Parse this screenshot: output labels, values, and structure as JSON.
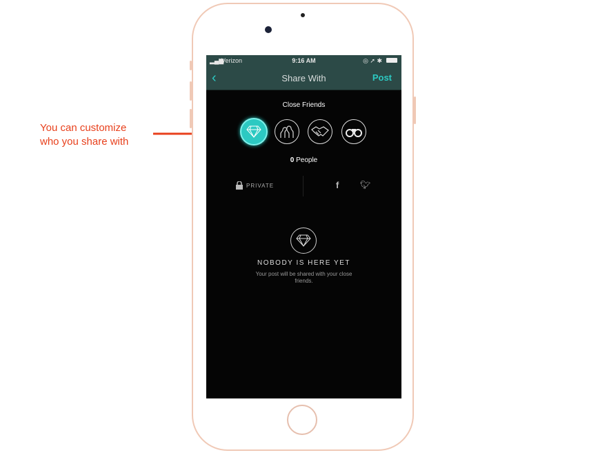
{
  "annotation": {
    "text_line1": "You can customize",
    "text_line2": "who you share with",
    "color": "#e8401c"
  },
  "status_bar": {
    "carrier": "Verizon",
    "time": "9:16 AM"
  },
  "nav": {
    "title": "Share With",
    "post_label": "Post",
    "accent": "#2cc9c2"
  },
  "audience": {
    "selected_label": "Close Friends",
    "options": [
      "diamond-icon",
      "group-icon",
      "handshake-icon",
      "binoculars-icon"
    ],
    "count_label": "0 People",
    "count": "0"
  },
  "privacy": {
    "private_label": "PRIVATE",
    "facebook_glyph": "f",
    "twitter_glyph": "twitter-icon"
  },
  "empty_state": {
    "title": "NOBODY IS HERE YET",
    "message": "Your post will be shared with your close friends."
  }
}
